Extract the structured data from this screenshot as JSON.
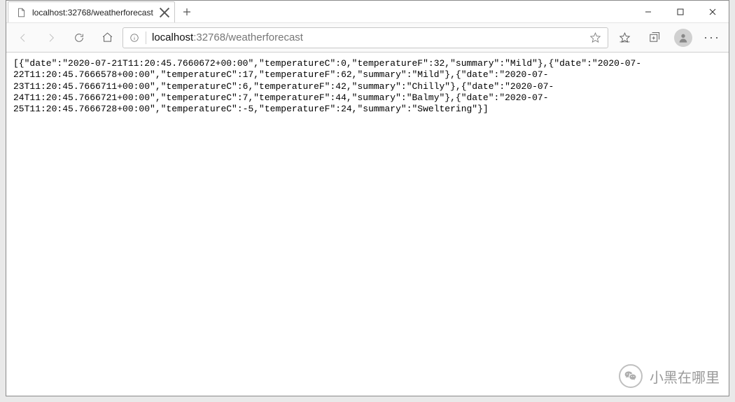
{
  "window": {
    "tab_title": "localhost:32768/weatherforecast",
    "url_host": "localhost",
    "url_path": ":32768/weatherforecast"
  },
  "icons": {
    "page": "page-icon",
    "close": "close-icon",
    "newtab": "plus-icon",
    "min": "minimize-icon",
    "max": "maximize-icon",
    "winclose": "window-close-icon",
    "back": "back-icon",
    "forward": "forward-icon",
    "refresh": "refresh-icon",
    "home": "home-icon",
    "info": "info-icon",
    "star": "star-icon",
    "favorites": "favorites-bar-icon",
    "collections": "collections-icon",
    "profile": "profile-avatar",
    "more": "more-icon",
    "wechat": "wechat-icon"
  },
  "watermark_text": "小黑在哪里",
  "weather": [
    {
      "date": "2020-07-21T11:20:45.7660672+00:00",
      "temperatureC": 0,
      "temperatureF": 32,
      "summary": "Mild"
    },
    {
      "date": "2020-07-22T11:20:45.7666578+00:00",
      "temperatureC": 17,
      "temperatureF": 62,
      "summary": "Mild"
    },
    {
      "date": "2020-07-23T11:20:45.7666711+00:00",
      "temperatureC": 6,
      "temperatureF": 42,
      "summary": "Chilly"
    },
    {
      "date": "2020-07-24T11:20:45.7666721+00:00",
      "temperatureC": 7,
      "temperatureF": 44,
      "summary": "Balmy"
    },
    {
      "date": "2020-07-25T11:20:45.7666728+00:00",
      "temperatureC": -5,
      "temperatureF": 24,
      "summary": "Sweltering"
    }
  ]
}
